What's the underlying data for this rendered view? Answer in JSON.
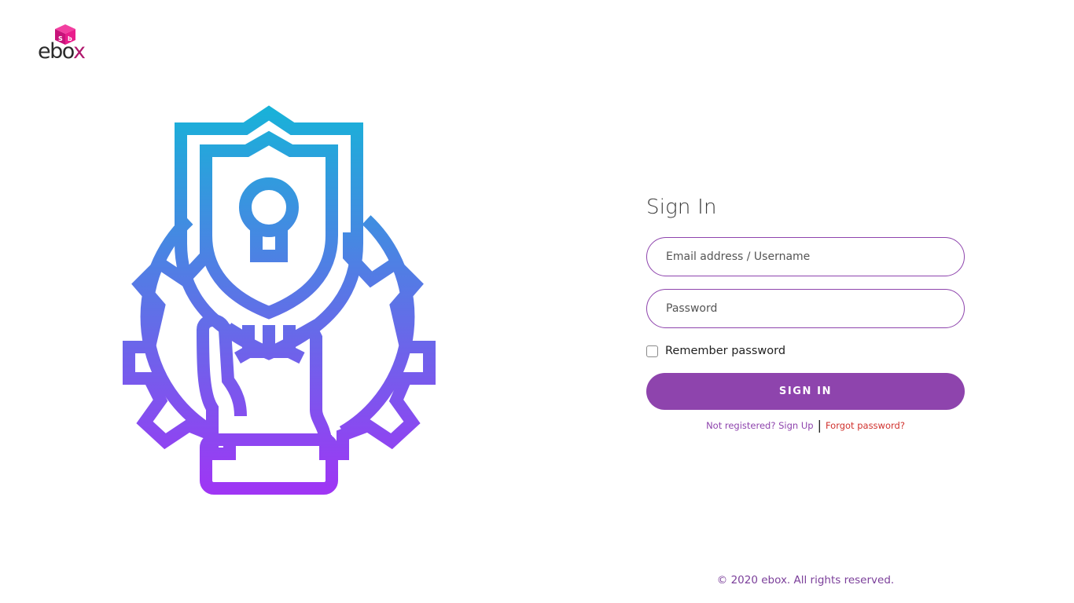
{
  "brand": {
    "logo_text_main": "ebo",
    "logo_text_accent": "x",
    "logo_icon": "cube-icon",
    "colors": {
      "text": "#2b2b2b",
      "accent": "#b0186d",
      "cube": "#e91e8c"
    }
  },
  "illustration": {
    "icon": "security-shield-hand-icon",
    "gradient": {
      "top": "#16b4d8",
      "bottom": "#a233f5"
    }
  },
  "signin": {
    "title": "Sign In",
    "email_placeholder": "Email address / Username",
    "password_placeholder": "Password",
    "remember_label": "Remember password",
    "remember_checked": false,
    "button_label": "SIGN IN",
    "signup_link": "Not registered? Sign Up",
    "separator": "|",
    "forgot_link": "Forgot password?"
  },
  "footer": {
    "text": "© 2020 ebox. All rights reserved."
  },
  "theme": {
    "primary": "#8e44ad",
    "danger": "#d0312d"
  }
}
